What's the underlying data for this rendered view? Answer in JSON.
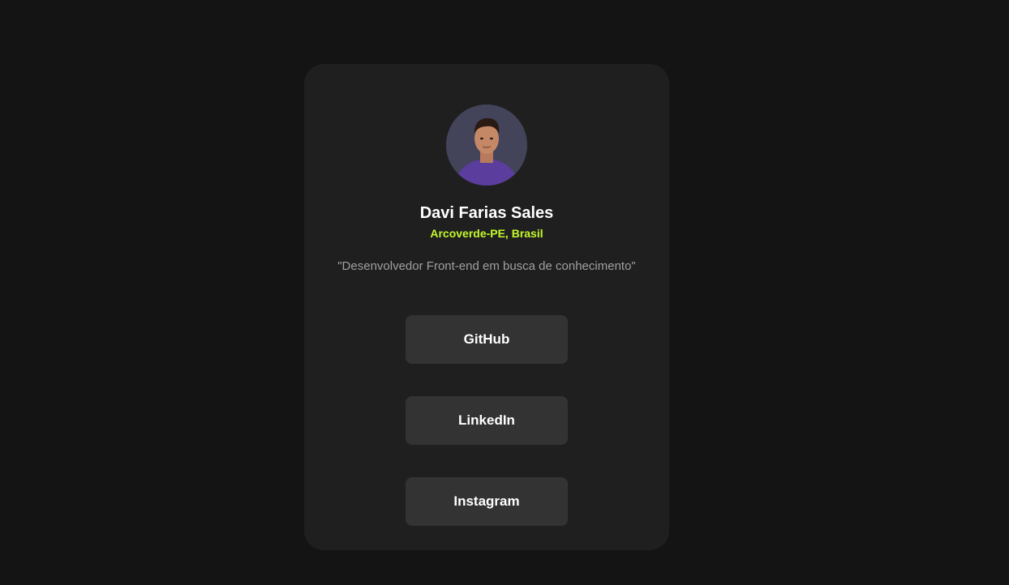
{
  "profile": {
    "name": "Davi Farias Sales",
    "location": "Arcoverde-PE, Brasil",
    "bio": "\"Desenvolvedor Front-end em busca de conhecimento\"",
    "avatar_icon": "profile-photo"
  },
  "links": [
    {
      "label": "GitHub"
    },
    {
      "label": "LinkedIn"
    },
    {
      "label": "Instagram"
    }
  ],
  "colors": {
    "page_background": "#141414",
    "card_background": "#1f1f1f",
    "button_background": "#333333",
    "accent": "#c4f82a",
    "bio_text": "#a0a0a0"
  }
}
